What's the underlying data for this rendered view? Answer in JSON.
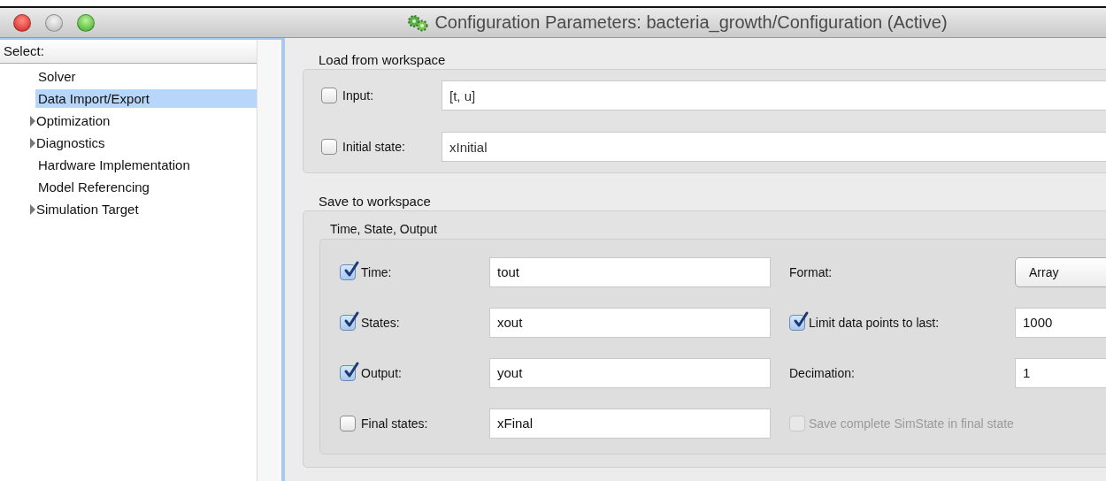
{
  "window": {
    "title": "Configuration Parameters: bacteria_growth/Configuration (Active)"
  },
  "sidebar": {
    "header": "Select:",
    "items": [
      {
        "label": "Solver",
        "kind": "page",
        "selected": false
      },
      {
        "label": "Data Import/Export",
        "kind": "page",
        "selected": true
      },
      {
        "label": "Optimization",
        "kind": "group",
        "expanded": false,
        "selected": false
      },
      {
        "label": "Diagnostics",
        "kind": "group",
        "expanded": false,
        "selected": false
      },
      {
        "label": "Hardware Implementation",
        "kind": "page",
        "selected": false
      },
      {
        "label": "Model Referencing",
        "kind": "page",
        "selected": false
      },
      {
        "label": "Simulation Target",
        "kind": "group",
        "expanded": false,
        "selected": false
      }
    ]
  },
  "load_from_workspace": {
    "title": "Load from workspace",
    "rows": [
      {
        "label": "Input:",
        "checked": false,
        "value": "[t, u]"
      },
      {
        "label": "Initial state:",
        "checked": false,
        "value": "xInitial"
      }
    ]
  },
  "save_to_workspace": {
    "title": "Save to workspace",
    "group": {
      "title": "Time, State, Output",
      "rows": [
        {
          "label": "Time:",
          "checked": true,
          "value": "tout",
          "option": {
            "kind": "dropdown",
            "label": "Format:",
            "value": "Array"
          }
        },
        {
          "label": "States:",
          "checked": true,
          "value": "xout",
          "option": {
            "kind": "checkbox",
            "label": "Limit data points to last:",
            "checked": true,
            "disabled": false,
            "value": "1000"
          }
        },
        {
          "label": "Output:",
          "checked": true,
          "value": "yout",
          "option": {
            "kind": "text",
            "label": "Decimation:",
            "value": "1"
          }
        },
        {
          "label": "Final states:",
          "checked": false,
          "value": "xFinal",
          "option": {
            "kind": "checkbox",
            "label": "Save complete SimState in final state",
            "checked": false,
            "disabled": true
          }
        }
      ]
    }
  }
}
